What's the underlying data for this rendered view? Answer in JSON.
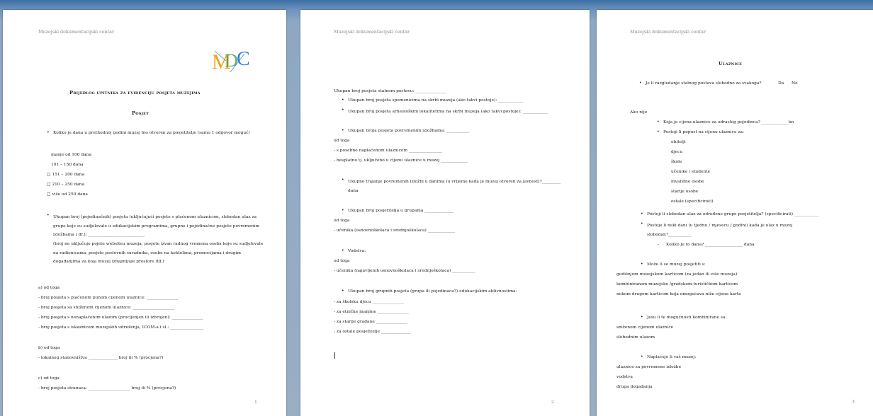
{
  "header": "Muzejski dokumentacijski centar",
  "page1": {
    "title": "Prijedlog upitnika za evidenciju posjeta muzejima",
    "subtitle": "Posjet",
    "q1": "Koliko je dana u prethodnoj godini muzej bio otvoren za posjetitelje (samo 1 odgovor moguć)",
    "options": [
      "manje od 100 dana",
      "101 – 150 dana",
      "□ 151 – 200 dana",
      "□ 210 – 250 dana",
      "□ više od 250 dana"
    ],
    "q2": "Ukupan broj (pojedinačnih) posjeta (uključujući posjete s plaćenom ulaznicom, slobodan ulaz za grupe koje su sudjelovale u edukacijskim programima, grupne i pojedinačne posjete povremenim izložbama i dr.): ___________________________",
    "q2_note": "(broj ne uključuje pojete websiteu muzeja, posjete izvan radnog vremena osoba koje su sudjelovale na radionicama, posjete poslovnih suradnika, osobe na koktelima, promocijama i drugim događanjima za koja muzej iznajmljuje prostore itd.)",
    "a_heading": "a) od toga",
    "a_lines": [
      "- broj posjeta s plaćenom punom cijenom ulaznice: _______________",
      "- broj posjeta sa sniženom cijenom ulaznice: ____________________",
      "- broj posjeta s nenaplaćenim ulazom (procijenjen ili izbrojen): _______________",
      "- broj posjeta s iskaznicom muzejskih udruženja, ICOM-a i sl.: ________________"
    ],
    "b_heading": "b) od toga",
    "b_lines": [
      "- lokalnog stanovništva ______________ broj ili % (procjena?)"
    ],
    "c_heading": "c) od toga",
    "c_lines": [
      "- broj posjeta stranaca: ____________________ broj ili % (procjena?)"
    ],
    "page_number": "1"
  },
  "page2": {
    "intro": "Ukupan broj posjeta stalnom postavu: _______________",
    "bullets1": [
      "Ukupan broj posjeta spomenicima na skrbi muzeja (ako takvi postoje): ____________",
      "Ukupan broj posjeta arheološkim lokalitetima na skrbi muzeja (ako takvi postoje): ____________",
      "Ukupan broja posjeta povremenim izložbama: ___________"
    ],
    "od_toga": "od toga",
    "lines1": [
      "- s posebno naplaćenom ulaznicom ________________",
      "- besplatno tj. uključeno u cijenu ulaznice u muzej _____________"
    ],
    "bullet2": "Ukupno trajanje povremenih izložbi u danima (u vrijeme kada je muzej otvoren za javnost)?_________ dana",
    "bullet3": "Ukupan broj posjetitelja u grupama ______________",
    "lines3": [
      "- učenika (osnovnoškolaca i srednjoškolaca) _____________"
    ],
    "bullet4": "Vodstva:",
    "lines4": [
      "- učenika (najavljenih osnovnoškolaca i srednjoškolaca) ___________"
    ],
    "bullet5": "Ukupan broj grupnih posjeta (grupa ili pojedinaca?) edukacijskim aktivnostima:",
    "lines5": [
      "- za školsku djecu _______________",
      "- za etničke manjine _______________",
      "- za starije građane _______________",
      "- za ostale posjetitelje ______________"
    ],
    "page_number": "2"
  },
  "page3": {
    "title": "Ulaznice",
    "q1": "Je li razgledanje stalnog postava slobodno za svakoga?",
    "q1_yes": "Da",
    "q1_no": "Ne",
    "ako_nije": "Ako nije",
    "sub_bullets": [
      "Koja je cijena ulaznice za odraslog pojedinca? _____________kn",
      "Postoji li popust na cijenu ulaznice za:"
    ],
    "discounts": [
      "obitelji",
      "djecu",
      "škole",
      "učenike / studente",
      "invalidne osobe",
      "starije osobe",
      "ostale (specificirati)"
    ],
    "bullets2": [
      "Postoji li slobodan ulaz za određene grupe posjetitelja? (specificirati) ____________",
      "Postoje li neki dani (u tjednu / mjesecu / godini) kada je ulaz u muzej slobodan?___________"
    ],
    "dash_item": "Koliko je to dana? __________________ dana",
    "q2": "Može li se muzej posjetiti s:",
    "q2_lines": [
      "godišnjom muzejskom karticom (za jedan ili više muzeja)",
      "kombiniranom muzejsko /gradskom-turističkom karticom",
      "nekom drugom karticom koja omogućava nižu cijenu karte"
    ],
    "q3": "Jesu li te mogućnosti kombinirane sa:",
    "q3_lines": [
      "sniženom cijenom ulaznice",
      "slobodnim ulazom"
    ],
    "q4": "Naplaćuje li vaš muzej:",
    "q4_lines": [
      "ulaznice za povremene izložbe",
      "vodstva",
      "druga događanja"
    ],
    "page_number": "3"
  },
  "colors": {
    "chrome": "#6d93bd",
    "logo_blue": "#2f7fd0",
    "logo_orange": "#f0a11a",
    "logo_green": "#4aa54a"
  }
}
